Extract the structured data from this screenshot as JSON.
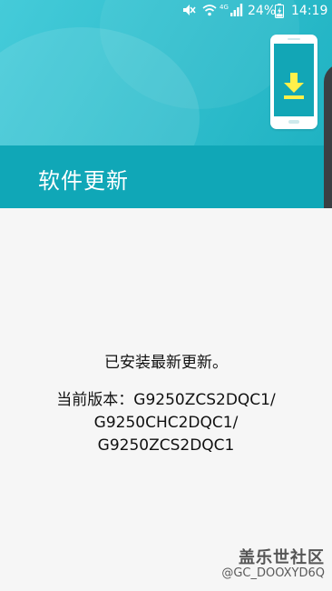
{
  "status_bar": {
    "network_type": "4G",
    "battery_percent": "24%",
    "battery_level": 0.24,
    "time": "14:19",
    "icons": [
      "mute-icon",
      "wifi-icon",
      "signal-icon",
      "battery-charging-icon"
    ]
  },
  "header": {
    "title": "软件更新",
    "illustration_icon": "download-icon",
    "accent_color": "#11aab9",
    "icon_color": "#fff04a"
  },
  "content": {
    "status_message": "已安装最新更新。",
    "version_lines": [
      "当前版本：G9250ZCS2DQC1/",
      "G9250CHC2DQC1/",
      "G9250ZCS2DQC1"
    ]
  },
  "watermark": {
    "brand": "盖乐世社区",
    "user": "@GC_DOOXYD6Q"
  }
}
